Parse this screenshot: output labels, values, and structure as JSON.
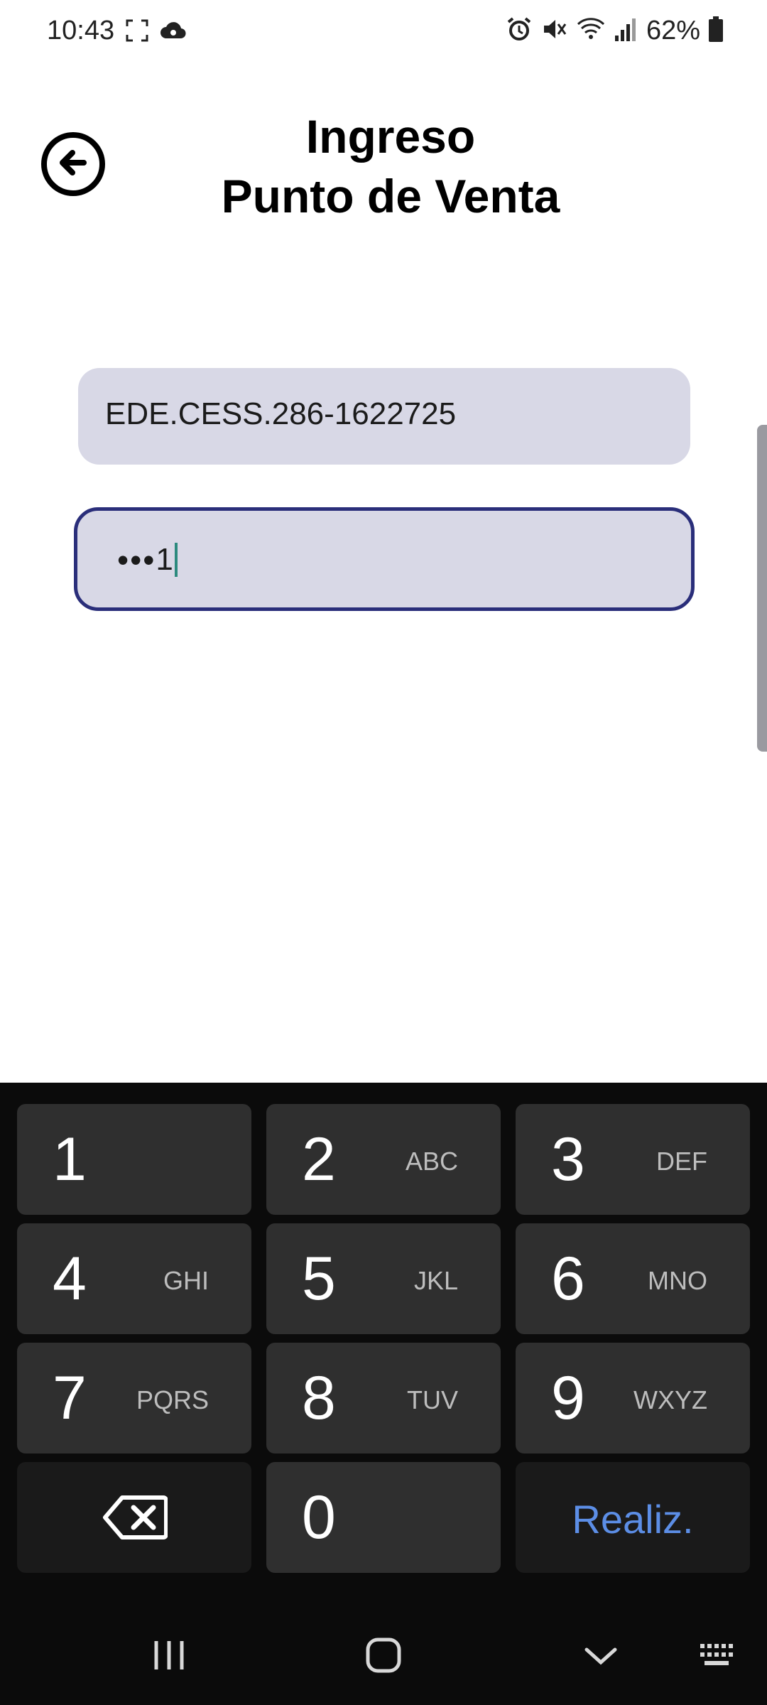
{
  "status_bar": {
    "time": "10:43",
    "battery": "62%",
    "left_icons": [
      "screenshot-icon",
      "cloud-sync-icon"
    ],
    "right_icons": [
      "alarm-icon",
      "mute-icon",
      "wifi-icon",
      "signal-icon",
      "battery-icon"
    ]
  },
  "header": {
    "title_line1": "Ingreso",
    "title_line2": "Punto de Venta"
  },
  "form": {
    "user_value": "EDE.CESS.286-1622725",
    "password_masked": "•••",
    "password_last_char": "1"
  },
  "keyboard": {
    "keys": [
      {
        "digit": "1",
        "letters": ""
      },
      {
        "digit": "2",
        "letters": "ABC"
      },
      {
        "digit": "3",
        "letters": "DEF"
      },
      {
        "digit": "4",
        "letters": "GHI"
      },
      {
        "digit": "5",
        "letters": "JKL"
      },
      {
        "digit": "6",
        "letters": "MNO"
      },
      {
        "digit": "7",
        "letters": "PQRS"
      },
      {
        "digit": "8",
        "letters": "TUV"
      },
      {
        "digit": "9",
        "letters": "WXYZ"
      },
      {
        "digit": "0",
        "letters": ""
      }
    ],
    "done_label": "Realiz.",
    "done_color": "#5c8ee6"
  },
  "colors": {
    "field_bg": "#d8d8e6",
    "focus_border": "#2a2e7a",
    "keyboard_bg": "#0b0b0b"
  }
}
